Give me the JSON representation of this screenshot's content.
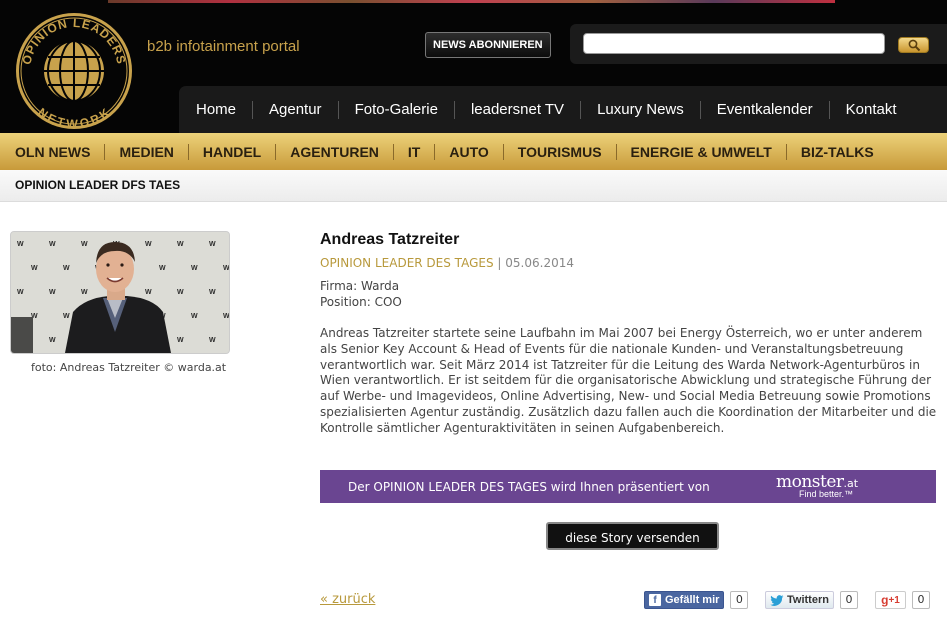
{
  "header": {
    "logo_text_top": "OPINION LEADERS",
    "logo_text_bottom": "NETWORK",
    "tagline": "b2b infotainment portal",
    "newsletter_button": "NEWS ABONNIEREN",
    "search": {
      "value": "",
      "placeholder": ""
    }
  },
  "main_nav": {
    "items": [
      {
        "label": "Home"
      },
      {
        "label": "Agentur"
      },
      {
        "label": "Foto-Galerie"
      },
      {
        "label": "leadersnet TV"
      },
      {
        "label": "Luxury News"
      },
      {
        "label": "Eventkalender"
      },
      {
        "label": "Kontakt"
      }
    ]
  },
  "category_nav": {
    "items": [
      {
        "label": "OLN NEWS"
      },
      {
        "label": "MEDIEN"
      },
      {
        "label": "HANDEL"
      },
      {
        "label": "AGENTUREN"
      },
      {
        "label": "IT"
      },
      {
        "label": "AUTO"
      },
      {
        "label": "TOURISMUS"
      },
      {
        "label": "ENERGIE & UMWELT"
      },
      {
        "label": "BIZ-TALKS"
      }
    ]
  },
  "section": {
    "title": "OPINION LEADER DFS TAES"
  },
  "photo": {
    "caption": "foto: Andreas Tatzreiter © warda.at",
    "backdrop_logo": "W"
  },
  "article": {
    "name": "Andreas Tatzreiter",
    "category": "OPINION LEADER DES TAGES",
    "separator": "|",
    "date": "05.06.2014",
    "firma": "Firma: Warda",
    "position": "Position: COO",
    "body": "Andreas Tatzreiter startete seine Laufbahn im Mai 2007 bei Energy Österreich, wo er unter anderem als Senior Key Account & Head of Events für die nationale Kunden- und Veranstaltungsbetreuung verantwortlich war. Seit März 2014 ist Tatzreiter für die Leitung des Warda Network-Agenturbüros in Wien verantwortlich. Er ist seitdem für die organisatorische Abwicklung und strategische Führung der auf Werbe- und Imagevideos, Online Advertising, New- und Social Media Betreuung sowie Promotions spezialisierten Agentur zuständig. Zusätzlich dazu fallen auch die Koordination der Mitarbeiter und die Kontrolle sämtlicher Agenturaktivitäten in seinen Aufgabenbereich."
  },
  "sponsor": {
    "text": "Der OPINION LEADER DES TAGES wird Ihnen präsentiert von",
    "brand": "monster",
    "brand_suffix": ".at",
    "brand_tagline": "Find better.™"
  },
  "actions": {
    "send_story": "diese Story versenden",
    "back": "« zurück"
  },
  "social": {
    "facebook": {
      "label": "Gefällt mir",
      "icon": "f",
      "count": "0"
    },
    "twitter": {
      "label": "Twittern",
      "count": "0"
    },
    "gplus": {
      "label": "+1",
      "icon": "g",
      "count": "0"
    }
  },
  "colors": {
    "gold": "#c8a24c",
    "purple": "#6a4591",
    "link": "#b8993c",
    "facebook": "#4a66a0"
  }
}
